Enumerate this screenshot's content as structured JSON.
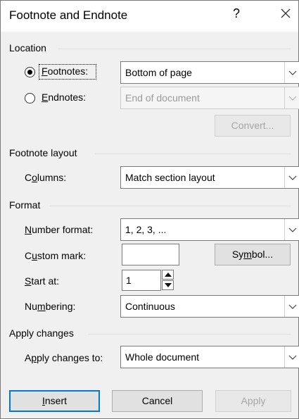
{
  "dialog": {
    "title": "Footnote and Endnote",
    "help_label": "?",
    "close_label": "✕"
  },
  "location": {
    "heading": "Location",
    "footnotes_label": "Footnotes:",
    "footnotes_value": "Bottom of page",
    "footnotes_selected": true,
    "endnotes_label": "Endnotes:",
    "endnotes_value": "End of document",
    "convert_label": "Convert..."
  },
  "layout": {
    "heading": "Footnote layout",
    "columns_label": "Columns:",
    "columns_value": "Match section layout"
  },
  "format": {
    "heading": "Format",
    "number_format_label": "Number format:",
    "number_format_value": "1, 2, 3, ...",
    "custom_mark_label": "Custom mark:",
    "custom_mark_value": "",
    "symbol_label": "Symbol...",
    "start_at_label": "Start at:",
    "start_at_value": "1",
    "numbering_label": "Numbering:",
    "numbering_value": "Continuous"
  },
  "apply": {
    "heading": "Apply changes",
    "apply_to_label": "Apply changes to:",
    "apply_to_value": "Whole document"
  },
  "buttons": {
    "insert": "Insert",
    "cancel": "Cancel",
    "apply": "Apply"
  },
  "icons": {
    "dropdown": "chevron-down-icon",
    "spinner_up": "triangle-up-icon",
    "spinner_down": "triangle-down-icon",
    "close": "close-icon",
    "help": "help-icon"
  },
  "colors": {
    "accent": "#0078d7",
    "dialog_bg": "#f0f0f0",
    "disabled_text": "#a6a6a6"
  }
}
